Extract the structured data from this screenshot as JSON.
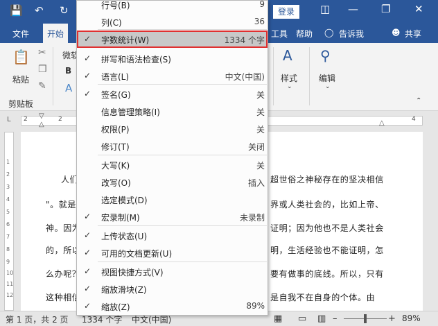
{
  "titlebar": {
    "login_label": "登录",
    "share_label": "共享"
  },
  "tabs": [
    "文件",
    "开始"
  ],
  "right_tabs": {
    "tools_label": "工具",
    "help_label": "帮助",
    "tell_me_label": "告诉我"
  },
  "ribbon": {
    "paste_label": "粘贴",
    "clipboard_label": "剪贴板",
    "font_partial": "微软",
    "styles_label": "样式",
    "editing_label": "编辑"
  },
  "ruler": {
    "numbers": [
      "2",
      "2",
      "4"
    ]
  },
  "vruler": {
    "numbers": [
      "1",
      "2",
      "3",
      "4",
      "5",
      "6",
      "7",
      "8",
      "9",
      "10",
      "11",
      "12"
    ]
  },
  "document": {
    "left_fragments": [
      "人们",
      "\"。就是",
      "神。因为",
      "的，所以",
      "么办呢？",
      "这种相信"
    ],
    "right_fragments": [
      "超世俗之神秘存在的坚决相信",
      "界或人类社会的，比如上帝、",
      "证明；因为他也不是人类社会",
      "明，生活经验也不能证明，怎",
      "要有做事的底线。所以，只有",
      "是自我不在自身的个体。由"
    ]
  },
  "statusbar": {
    "page_info": "第 1 页，共 2 页",
    "word_count": "1334 个字",
    "language": "中文(中国)",
    "zoom": "89%"
  },
  "context_menu": {
    "items": [
      {
        "label": "行号(B)",
        "value": "9",
        "checked": false
      },
      {
        "label": "列(C)",
        "value": "36",
        "checked": false
      },
      {
        "label": "字数统计(W)",
        "value": "1334 个字",
        "checked": true,
        "highlighted": true
      },
      {
        "label": "拼写和语法检查(S)",
        "value": "",
        "checked": true
      },
      {
        "label": "语言(L)",
        "value": "中文(中国)",
        "checked": true
      },
      {
        "label": "签名(G)",
        "value": "关",
        "checked": true
      },
      {
        "label": "信息管理策略(I)",
        "value": "关",
        "checked": false
      },
      {
        "label": "权限(P)",
        "value": "关",
        "checked": false
      },
      {
        "label": "修订(T)",
        "value": "关闭",
        "checked": false
      },
      {
        "label": "大写(K)",
        "value": "关",
        "checked": false
      },
      {
        "label": "改写(O)",
        "value": "插入",
        "checked": false
      },
      {
        "label": "选定模式(D)",
        "value": "",
        "checked": false
      },
      {
        "label": "宏录制(M)",
        "value": "未录制",
        "checked": true
      },
      {
        "label": "上传状态(U)",
        "value": "",
        "checked": true
      },
      {
        "label": "可用的文档更新(U)",
        "value": "",
        "checked": true
      },
      {
        "label": "视图快捷方式(V)",
        "value": "",
        "checked": true
      },
      {
        "label": "缩放滑块(Z)",
        "value": "",
        "checked": true
      },
      {
        "label": "缩放(Z)",
        "value": "89%",
        "checked": true
      }
    ]
  }
}
